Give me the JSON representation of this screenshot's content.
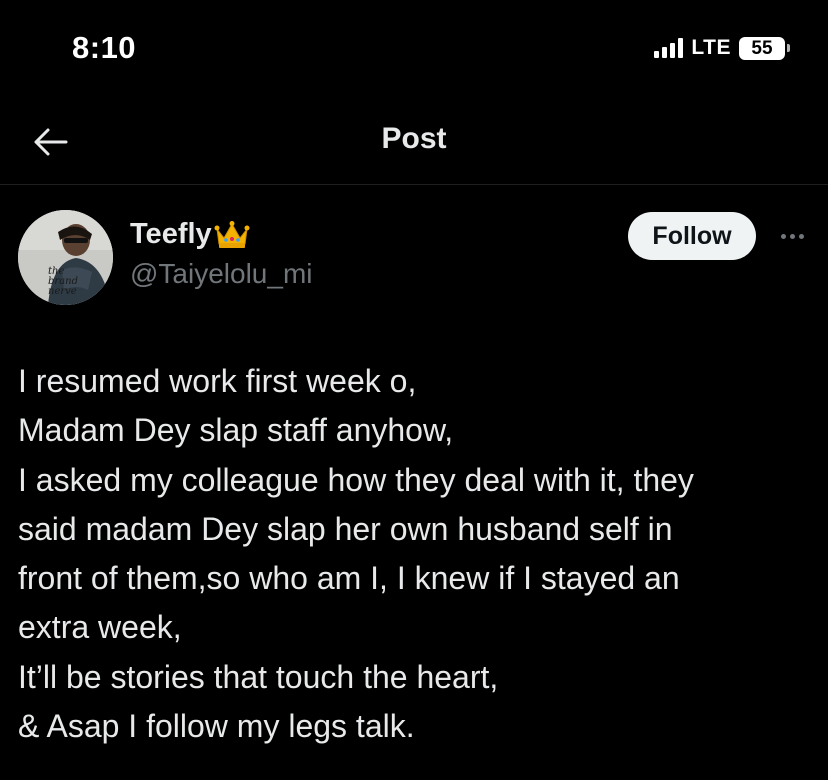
{
  "status_bar": {
    "time": "8:10",
    "network": "LTE",
    "battery": "55"
  },
  "header": {
    "title": "Post",
    "back_icon": "arrow-left-icon"
  },
  "author": {
    "name": "Teefly",
    "badge_icon": "crown-icon",
    "handle": "@Taiyelolu_mi",
    "avatar_text": [
      "the",
      "brand",
      "nerve"
    ]
  },
  "actions": {
    "follow_label": "Follow",
    "more_icon": "more-horizontal-icon"
  },
  "post": {
    "lines": [
      "I resumed work first week o,",
      "Madam Dey slap staff anyhow,",
      "I asked my colleague how they deal with it, they",
      "said madam Dey slap her own husband self in",
      "front of them,so who am I, I knew if I stayed an",
      "extra week,",
      "It’ll be stories that touch the heart,",
      "& Asap I follow my legs talk."
    ]
  },
  "colors": {
    "background": "#000000",
    "text_primary": "#e7e9ea",
    "text_secondary": "#71767b",
    "follow_bg": "#eff3f4",
    "crown": "#f5b301"
  }
}
